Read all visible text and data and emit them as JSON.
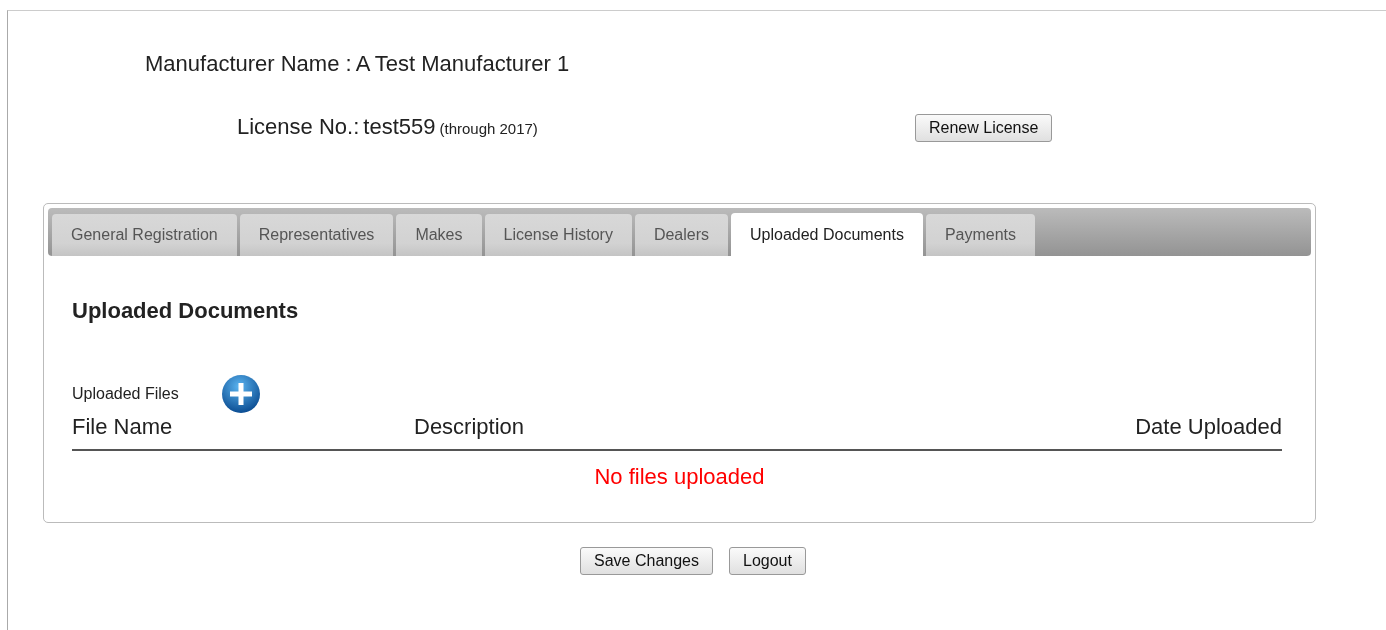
{
  "manufacturer": {
    "label": "Manufacturer Name :",
    "value": "A Test Manufacturer 1"
  },
  "license": {
    "label": "License No.:",
    "value": "test559",
    "note": "(through 2017)",
    "renew_button": "Renew License"
  },
  "tabs": [
    {
      "label": "General Registration",
      "selected": false
    },
    {
      "label": "Representatives",
      "selected": false
    },
    {
      "label": "Makes",
      "selected": false
    },
    {
      "label": "License History",
      "selected": false
    },
    {
      "label": "Dealers",
      "selected": false
    },
    {
      "label": "Uploaded Documents",
      "selected": true
    },
    {
      "label": "Payments",
      "selected": false
    }
  ],
  "section": {
    "heading": "Uploaded Documents",
    "files_label": "Uploaded Files",
    "columns": [
      "File Name",
      "Description",
      "Date Uploaded"
    ],
    "empty_message": "No files uploaded"
  },
  "buttons": [
    "Save Changes",
    "Logout"
  ]
}
